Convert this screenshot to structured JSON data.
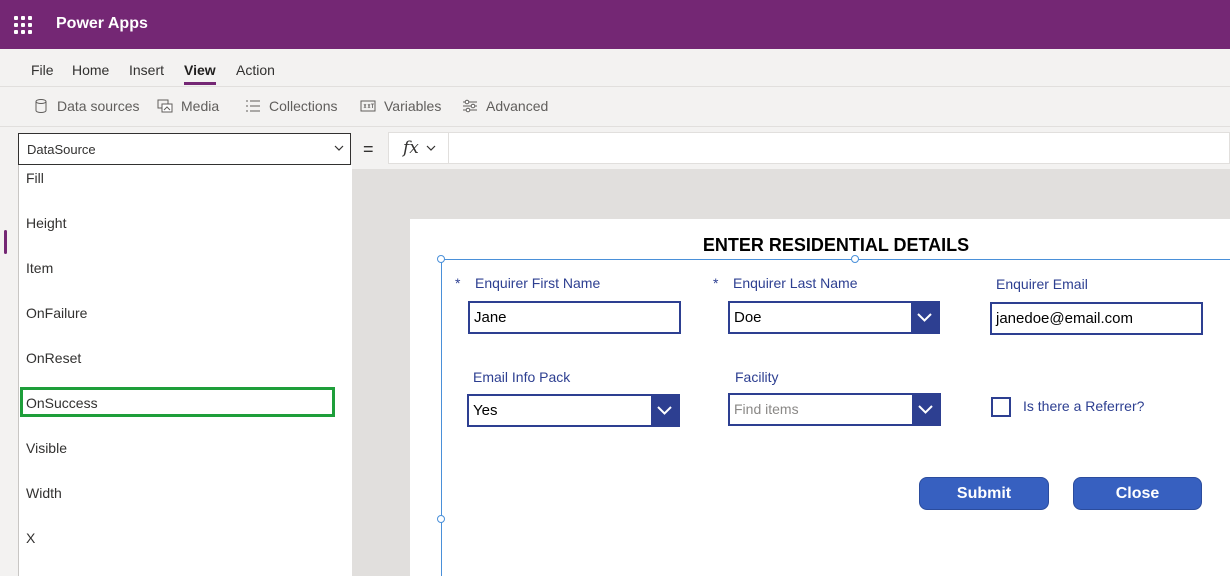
{
  "app": {
    "title": "Power Apps"
  },
  "menu": {
    "items": [
      "File",
      "Home",
      "Insert",
      "View",
      "Action"
    ],
    "active": "View"
  },
  "ribbon": {
    "items": [
      "Data sources",
      "Media",
      "Collections",
      "Variables",
      "Advanced"
    ]
  },
  "formula_bar": {
    "property": "DataSource",
    "equals": "=",
    "fx_label": "fx",
    "formula": ""
  },
  "property_list": {
    "items": [
      "Fill",
      "Height",
      "Item",
      "OnFailure",
      "OnReset",
      "OnSuccess",
      "Visible",
      "Width",
      "X"
    ],
    "highlighted": "OnSuccess"
  },
  "form": {
    "title": "ENTER RESIDENTIAL DETAILS",
    "required_marker": "*",
    "first_name": {
      "label": "Enquirer First Name",
      "value": "Jane"
    },
    "last_name": {
      "label": "Enquirer Last Name",
      "value": "Doe"
    },
    "email": {
      "label": "Enquirer Email",
      "value": "janedoe@email.com"
    },
    "info_pack": {
      "label": "Email Info Pack",
      "value": "Yes"
    },
    "facility": {
      "label": "Facility",
      "placeholder": "Find items"
    },
    "referrer": {
      "label": "Is there a Referrer?",
      "checked": false
    },
    "submit_label": "Submit",
    "close_label": "Close"
  },
  "colors": {
    "brand": "#742774",
    "form_accent": "#2d3f91",
    "button": "#3760c0",
    "highlight": "#1e9e3a"
  }
}
